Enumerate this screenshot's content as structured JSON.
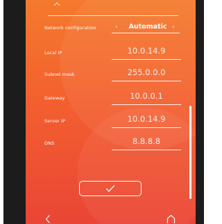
{
  "network_configuration": {
    "label": "Network configuration",
    "value": "Automatic",
    "prev_symbol": "‹",
    "next_symbol": "›"
  },
  "fields": [
    {
      "label": "Local IP",
      "value": "10.0.14.9"
    },
    {
      "label": "Subnet mask",
      "value": "255.0.0.0"
    },
    {
      "label": "Gateway",
      "value": "10.0.0.1"
    },
    {
      "label": "Server IP",
      "value": "10.0.14.9"
    },
    {
      "label": "DNS",
      "value": "8.8.8.8"
    }
  ],
  "icons": {
    "confirm": "checkmark-icon",
    "back": "chevron-left-icon",
    "home": "home-icon",
    "scroll_up": "chevron-up-icon"
  },
  "colors": {
    "gradient_top": "#f47a2c",
    "gradient_bottom": "#ea4535",
    "device_frame": "#1c1c1c",
    "foreground": "#ffffff"
  }
}
